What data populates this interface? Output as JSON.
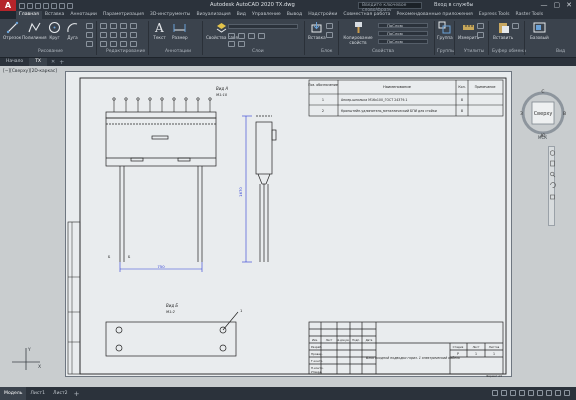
{
  "titlebar": {
    "logo": "A",
    "title": "Autodesk AutoCAD 2020   TX.dwg",
    "search_placeholder": "Введите ключевое слово/фразу",
    "signin": "Вход в службы",
    "window_controls": [
      "—",
      "▢",
      "✕"
    ]
  },
  "ribbon_tabs": [
    "Главная",
    "Вставка",
    "Аннотации",
    "Параметризация",
    "3D-инструменты",
    "Визуализация",
    "Вид",
    "Управление",
    "Вывод",
    "Надстройки",
    "Совместная работа",
    "Рекомендованные приложения",
    "Express Tools",
    "Raster Tools"
  ],
  "ribbon": {
    "tools": {
      "line": "Отрезок",
      "polyline": "Полилиния",
      "circle": "Круг",
      "arc": "Дуга",
      "text": "Текст",
      "dimension": "Размер",
      "layer_props": "Свойства слоя",
      "insert": "Вставка",
      "match_props": "Копирование свойств",
      "group": "Группа",
      "measure": "Измерить",
      "paste": "Вставить",
      "base": "Базовый"
    },
    "panels": [
      "Рисование",
      "Редактирование",
      "Аннотации",
      "Слои",
      "Блок",
      "Свойства",
      "Группы",
      "Утилиты",
      "Буфер обмена",
      "Вид"
    ],
    "combos": [
      "ПоСлою",
      "ПоСлою",
      "ПоСлою"
    ]
  },
  "filetabs": [
    "Начало",
    "TX"
  ],
  "viewport": {
    "label": "[−][Сверху][2D-каркас]",
    "viewcube_top": "Сверху",
    "compass": {
      "n": "С",
      "s": "Ю",
      "w": "З",
      "e": "В"
    },
    "wcs": "МСК"
  },
  "drawing": {
    "view_a": "Вид А",
    "view_a_scale": "М1:10",
    "view_b": "Вид Б",
    "view_b_scale": "М1:2",
    "dim_horizontal": "750",
    "dim_vertical": "1670",
    "callout": "1",
    "bom_headers": [
      "Поз. обозначение",
      "Наименование",
      "Кол.",
      "Примечание"
    ],
    "bom_rows": [
      [
        "1",
        "Анкер-шпилька М16х100_ГОСТ 24379.1",
        "8",
        ""
      ],
      [
        "2",
        "Кронштейн-удлинитель_металлический БПИ для стойки",
        "8",
        ""
      ]
    ],
    "title_block": {
      "rows": [
        "Разраб.",
        "Провер.",
        "Т.контр.",
        "Н.контр.",
        "Утверд."
      ],
      "cols": [
        "Изм.",
        "Лист",
        "№ докум.",
        "Подп.",
        "Дата"
      ],
      "name": "Блок входной подводки гориз. 1 электрический кабель",
      "stage_labels": [
        "Стадия",
        "Лист",
        "Листов"
      ],
      "stage_values": [
        "Р",
        "1",
        "1"
      ],
      "format": "Формат А3"
    }
  },
  "statusbar": {
    "tabs": [
      "Модель",
      "Лист1",
      "Лист2"
    ],
    "add": "+"
  }
}
